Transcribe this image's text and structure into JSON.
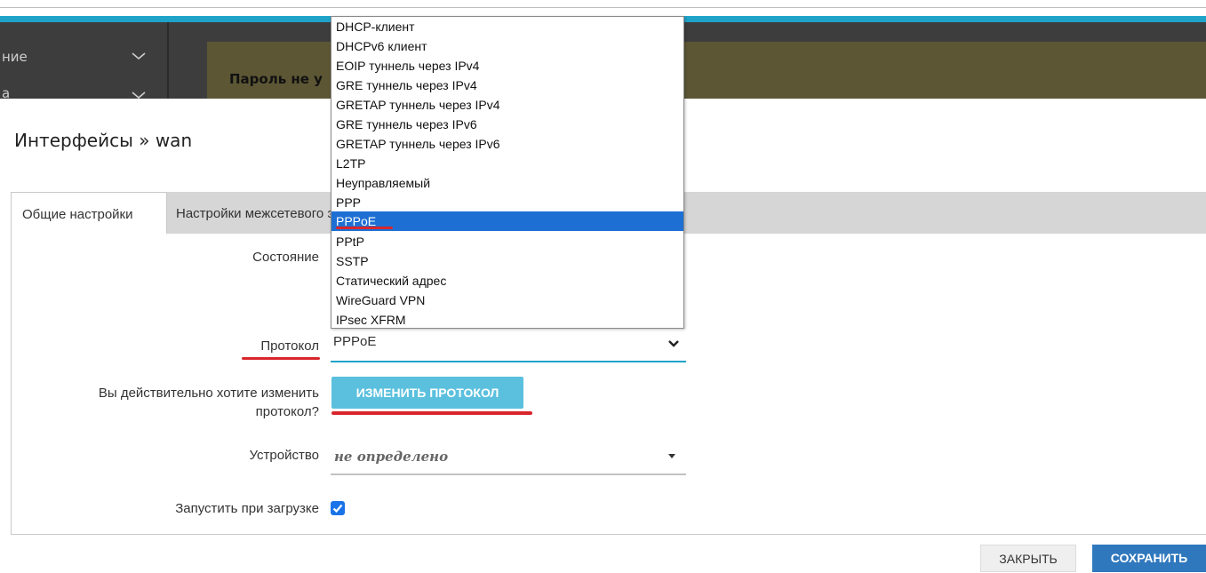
{
  "background": {
    "sidebar": [
      {
        "label": "ние"
      },
      {
        "label": "а"
      }
    ],
    "warning_text": "Пароль не у"
  },
  "modal": {
    "title": "Интерфейсы » wan",
    "tabs": [
      {
        "label": "Общие настройки",
        "active": true
      },
      {
        "label": "Настройки межсетевого экрана",
        "active": false
      }
    ],
    "fields": {
      "state_label": "Состояние",
      "protocol_label": "Протокол",
      "protocol_value": "PPPoE",
      "confirm_label_line1": "Вы действительно хотите изменить",
      "confirm_label_line2": "протокол?",
      "change_button": "ИЗМЕНИТЬ ПРОТОКОЛ",
      "device_label": "Устройство",
      "device_value": "не определено",
      "autostart_label": "Запустить при загрузке",
      "autostart_checked": true
    },
    "footer": {
      "close_button": "ЗАКРЫТЬ",
      "save_button": "СОХРАНИТЬ"
    }
  },
  "protocol_dropdown": {
    "options": [
      "DHCP-клиент",
      "DHCPv6 клиент",
      "EOIP туннель через IPv4",
      "GRE туннель через IPv4",
      "GRETAP туннель через IPv4",
      "GRE туннель через IPv6",
      "GRETAP туннель через IPv6",
      "L2TP",
      "Неуправляемый",
      "PPP",
      "PPPoE",
      "PPtP",
      "SSTP",
      "Статический адрес",
      "WireGuard VPN",
      "IPsec XFRM"
    ],
    "selected": "PPPoE"
  },
  "colors": {
    "accent": "#1fa3c9",
    "change_button": "#5bc0de",
    "save_button": "#2f78bd",
    "selected_option": "#1e6fd3",
    "annotation": "#d8262c"
  }
}
